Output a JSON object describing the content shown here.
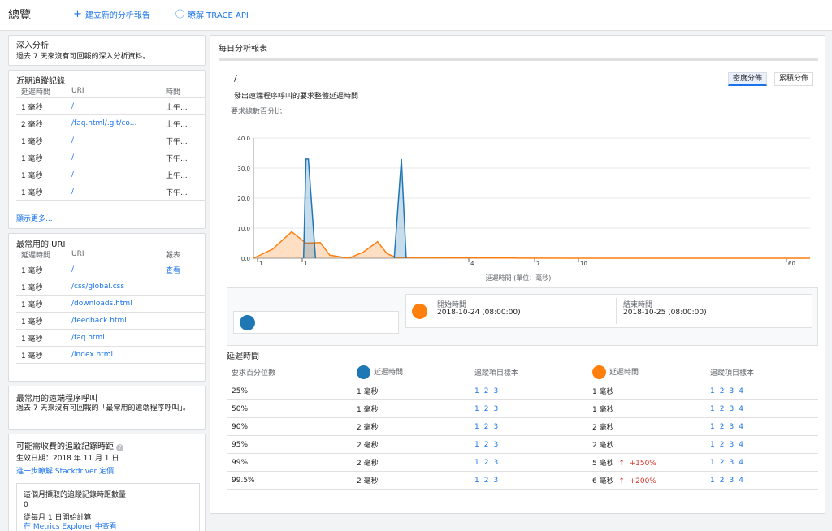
{
  "header": {
    "title": "總覽",
    "create_report": "建立新的分析報告",
    "trace_api": "瞭解 TRACE API"
  },
  "insights": {
    "title": "深入分析",
    "desc": "過去 7 天來沒有可回報的深入分析資料。"
  },
  "recent": {
    "title": "近期追蹤記錄",
    "col_latency": "延遲時間",
    "col_uri": "URI",
    "col_time": "時間",
    "rows": [
      {
        "latency": "1 毫秒",
        "uri": "/",
        "time": "上午..."
      },
      {
        "latency": "2 毫秒",
        "uri": "/faq.html/.git/co...",
        "time": "上午..."
      },
      {
        "latency": "1 毫秒",
        "uri": "/",
        "time": "下午..."
      },
      {
        "latency": "1 毫秒",
        "uri": "/",
        "time": "下午..."
      },
      {
        "latency": "1 毫秒",
        "uri": "/",
        "time": "上午..."
      },
      {
        "latency": "1 毫秒",
        "uri": "/",
        "time": "下午..."
      }
    ],
    "show_more": "顯示更多..."
  },
  "frequent": {
    "title": "最常用的 URI",
    "col_latency": "延遲時間",
    "col_uri": "URI",
    "col_report": "報表",
    "rows": [
      {
        "latency": "1 毫秒",
        "uri": "/",
        "report": "查看"
      },
      {
        "latency": "1 毫秒",
        "uri": "/css/global.css",
        "report": ""
      },
      {
        "latency": "1 毫秒",
        "uri": "/downloads.html",
        "report": ""
      },
      {
        "latency": "1 毫秒",
        "uri": "/feedback.html",
        "report": ""
      },
      {
        "latency": "1 毫秒",
        "uri": "/faq.html",
        "report": ""
      },
      {
        "latency": "1 毫秒",
        "uri": "/index.html",
        "report": ""
      }
    ]
  },
  "rpc": {
    "title": "最常用的遠端程序呼叫",
    "desc": "過去 7 天來沒有可回報的「最常用的遠端程序呼叫」。"
  },
  "billable": {
    "title": "可能需收費的追蹤記錄時距",
    "effective": "生效日期：2018 年 11 月 1 日",
    "learn": "進一步瞭解 Stackdriver 定價",
    "box_title": "這個月擷取的追蹤記錄時距數量",
    "count": "0",
    "since": "從每月 1 日開始計算",
    "metrics": "在 Metrics Explorer 中查看"
  },
  "daily": {
    "title": "每日分析報表",
    "uri": "/",
    "subtitle": "發出遠端程序呼叫的要求整體延遲時間",
    "ylabel": "要求總數百分比",
    "xlabel": "延遲時間 (單位：毫秒)",
    "density": "密度分佈",
    "cumulative": "累積分佈",
    "start_label": "開始時間",
    "start_value": "2018-10-24 (08:00:00)",
    "end_label": "結束時間",
    "end_value": "2018-10-25 (08:00:00)"
  },
  "colors": {
    "blue": "#1f77b4",
    "orange": "#ff7f0e",
    "link": "#1a73e8"
  },
  "chart_data": {
    "type": "area",
    "ylim": [
      0,
      40
    ],
    "yticks": [
      "0.0",
      "10.0",
      "20.0",
      "30.0",
      "40.0"
    ],
    "xticks": [
      "1",
      "1",
      "4",
      "7",
      "10",
      "60"
    ],
    "series": [
      {
        "name": "blue",
        "points": [
          [
            1.05,
            0
          ],
          [
            1.1,
            33
          ],
          [
            1.15,
            33
          ],
          [
            1.3,
            0
          ],
          [
            2.95,
            0
          ],
          [
            3.1,
            33
          ],
          [
            3.2,
            0
          ]
        ]
      },
      {
        "name": "orange",
        "points": [
          [
            0,
            0
          ],
          [
            0.4,
            3
          ],
          [
            0.8,
            8.8
          ],
          [
            1.1,
            5
          ],
          [
            1.4,
            5.2
          ],
          [
            1.6,
            1
          ],
          [
            2.0,
            0
          ],
          [
            2.3,
            2
          ],
          [
            2.6,
            5.5
          ],
          [
            2.8,
            1.5
          ],
          [
            3.0,
            0.2
          ],
          [
            8,
            0.05
          ],
          [
            20,
            0
          ]
        ]
      }
    ]
  },
  "latency": {
    "title": "延遲時間",
    "col_percentile": "要求百分位數",
    "col_latency": "延遲時間",
    "col_samples": "追蹤項目樣本",
    "rows": [
      {
        "pct": "25%",
        "a": "1 毫秒",
        "a_samples": [
          "1",
          "2",
          "3"
        ],
        "b": "1 毫秒",
        "b_change": "",
        "b_samples": [
          "1",
          "2",
          "3",
          "4"
        ]
      },
      {
        "pct": "50%",
        "a": "1 毫秒",
        "a_samples": [
          "1",
          "2",
          "3"
        ],
        "b": "1 毫秒",
        "b_change": "",
        "b_samples": [
          "1",
          "2",
          "3",
          "4"
        ]
      },
      {
        "pct": "90%",
        "a": "2 毫秒",
        "a_samples": [
          "1",
          "2",
          "3"
        ],
        "b": "2 毫秒",
        "b_change": "",
        "b_samples": [
          "1",
          "2",
          "3",
          "4"
        ]
      },
      {
        "pct": "95%",
        "a": "2 毫秒",
        "a_samples": [
          "1",
          "2",
          "3"
        ],
        "b": "2 毫秒",
        "b_change": "",
        "b_samples": [
          "1",
          "2",
          "3",
          "4"
        ]
      },
      {
        "pct": "99%",
        "a": "2 毫秒",
        "a_samples": [
          "1",
          "2",
          "3"
        ],
        "b": "5 毫秒",
        "b_change": "+150%",
        "b_samples": [
          "1",
          "2",
          "3",
          "4"
        ]
      },
      {
        "pct": "99.5%",
        "a": "2 毫秒",
        "a_samples": [
          "1",
          "2",
          "3"
        ],
        "b": "6 毫秒",
        "b_change": "+200%",
        "b_samples": [
          "1",
          "2",
          "3",
          "4"
        ]
      }
    ]
  }
}
